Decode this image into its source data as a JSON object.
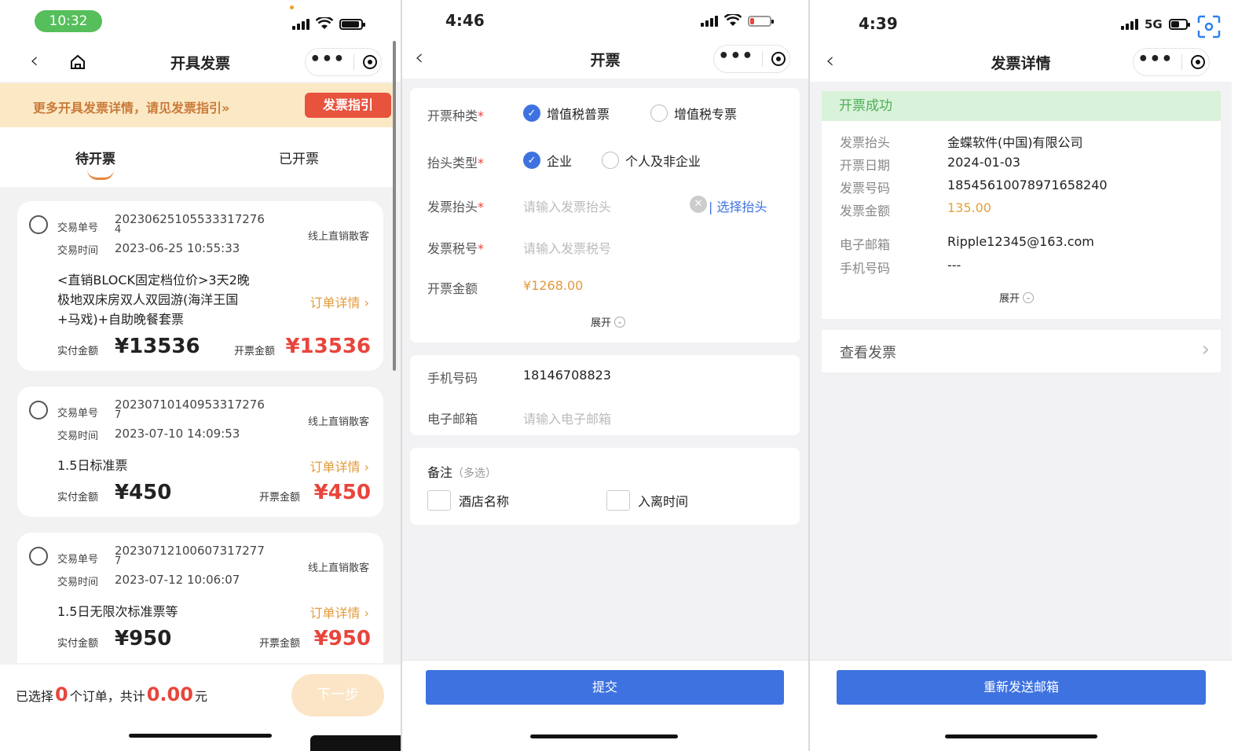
{
  "panel1": {
    "status": {
      "time": "10:32"
    },
    "nav": {
      "title": "开具发票"
    },
    "banner": {
      "text": "更多开具发票详情，请见发票指引»",
      "button": "发票指引"
    },
    "tabs": [
      {
        "label": "待开票"
      },
      {
        "label": "已开票"
      }
    ],
    "labels": {
      "trade_no": "交易单号",
      "trade_time": "交易时间",
      "paid": "实付金额",
      "invoice": "开票金额",
      "detail": "订单详情 ›"
    },
    "orders": [
      {
        "trade_no_l1": "20230625105533317276",
        "trade_no_l2": "4",
        "time": "2023-06-25 10:55:33",
        "seller": "线上直销散客",
        "product_lines": [
          "<直销BLOCK固定档位价>3天2晚",
          "极地双床房双人双园游(海洋王国",
          "+马戏)+自助晚餐套票"
        ],
        "paid": "¥13536",
        "invoice": "¥13536"
      },
      {
        "trade_no_l1": "20230710140953317276",
        "trade_no_l2": "7",
        "time": "2023-07-10 14:09:53",
        "seller": "线上直销散客",
        "product_lines": [
          "1.5日标准票"
        ],
        "paid": "¥450",
        "invoice": "¥450"
      },
      {
        "trade_no_l1": "20230712100607317277",
        "trade_no_l2": "7",
        "time": "2023-07-12 10:06:07",
        "seller": "线上直销散客",
        "product_lines": [
          "1.5日无限次标准票等"
        ],
        "paid": "¥950",
        "invoice": "¥950"
      }
    ],
    "bottom": {
      "selected_prefix": "已选择",
      "count": "0",
      "mid": "个订单，共计",
      "total": "0.00",
      "unit": "元",
      "next": "下一步"
    }
  },
  "panel2": {
    "status": {
      "time": "4:46"
    },
    "nav": {
      "title": "开票"
    },
    "fields": {
      "type_label": "开票种类",
      "type_opt1": "增值税普票",
      "type_opt2": "增值税专票",
      "header_type_label": "抬头类型",
      "header_opt1": "企业",
      "header_opt2": "个人及非企业",
      "title_label": "发票抬头",
      "title_placeholder": "请输入发票抬头",
      "choose_title": "选择抬头",
      "tax_label": "发票税号",
      "tax_placeholder": "请输入发票税号",
      "amount_label": "开票金额",
      "amount_value": "¥1268.00",
      "expand": "展开",
      "phone_label": "手机号码",
      "phone_value": "18146708823",
      "email_label": "电子邮箱",
      "email_placeholder": "请输入电子邮箱",
      "remark_label": "备注",
      "remark_hint": "（多选）",
      "remark_opt1": "酒店名称",
      "remark_opt2": "入离时间",
      "required_mark": "*"
    },
    "submit": "提交"
  },
  "panel3": {
    "status": {
      "time": "4:39",
      "network": "5G"
    },
    "nav": {
      "title": "发票详情"
    },
    "success": "开票成功",
    "details": [
      {
        "label": "发票抬头",
        "value": "金蝶软件(中国)有限公司"
      },
      {
        "label": "开票日期",
        "value": "2024-01-03"
      },
      {
        "label": "发票号码",
        "value": "18545610078971658240"
      },
      {
        "label": "发票金额",
        "value": "135.00"
      },
      {
        "label": "电子邮箱",
        "value": "Ripple12345@163.com"
      },
      {
        "label": "手机号码",
        "value": "---"
      }
    ],
    "expand": "展开",
    "view_invoice": "查看发票",
    "resend": "重新发送邮箱"
  },
  "colors": {
    "accent_blue": "#3e72e0",
    "price_red": "#e8453c",
    "orange": "#e39a3a",
    "success_green": "#4fae58",
    "time_pill_green": "#56bf5c"
  }
}
